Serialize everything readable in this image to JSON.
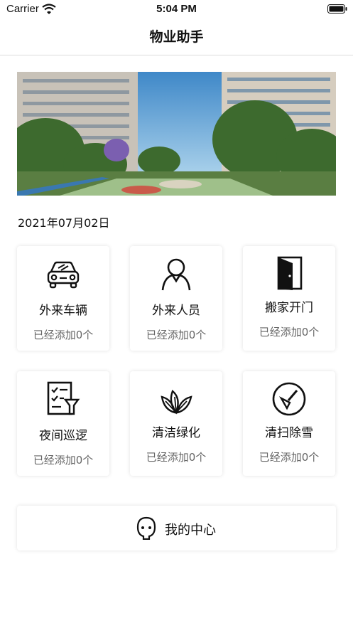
{
  "status_bar": {
    "carrier": "Carrier",
    "time": "5:04 PM"
  },
  "nav": {
    "title": "物业助手"
  },
  "date": "2021年07月02日",
  "cards": [
    {
      "title": "外来车辆",
      "count": "已经添加0个",
      "icon": "car-icon"
    },
    {
      "title": "外来人员",
      "count": "已经添加0个",
      "icon": "person-icon"
    },
    {
      "title": "搬家开门",
      "count": "已经添加0个",
      "icon": "door-icon"
    },
    {
      "title": "夜间巡逻",
      "count": "已经添加0个",
      "icon": "patrol-checklist-icon"
    },
    {
      "title": "清洁绿化",
      "count": "已经添加0个",
      "icon": "leaves-icon"
    },
    {
      "title": "清扫除雪",
      "count": "已经添加0个",
      "icon": "broom-icon"
    }
  ],
  "my_center": {
    "label": "我的中心",
    "icon": "face-icon"
  },
  "colors": {
    "background": "#ffffff",
    "text": "#111111",
    "muted": "#666666",
    "divider": "#dcdcdc"
  }
}
